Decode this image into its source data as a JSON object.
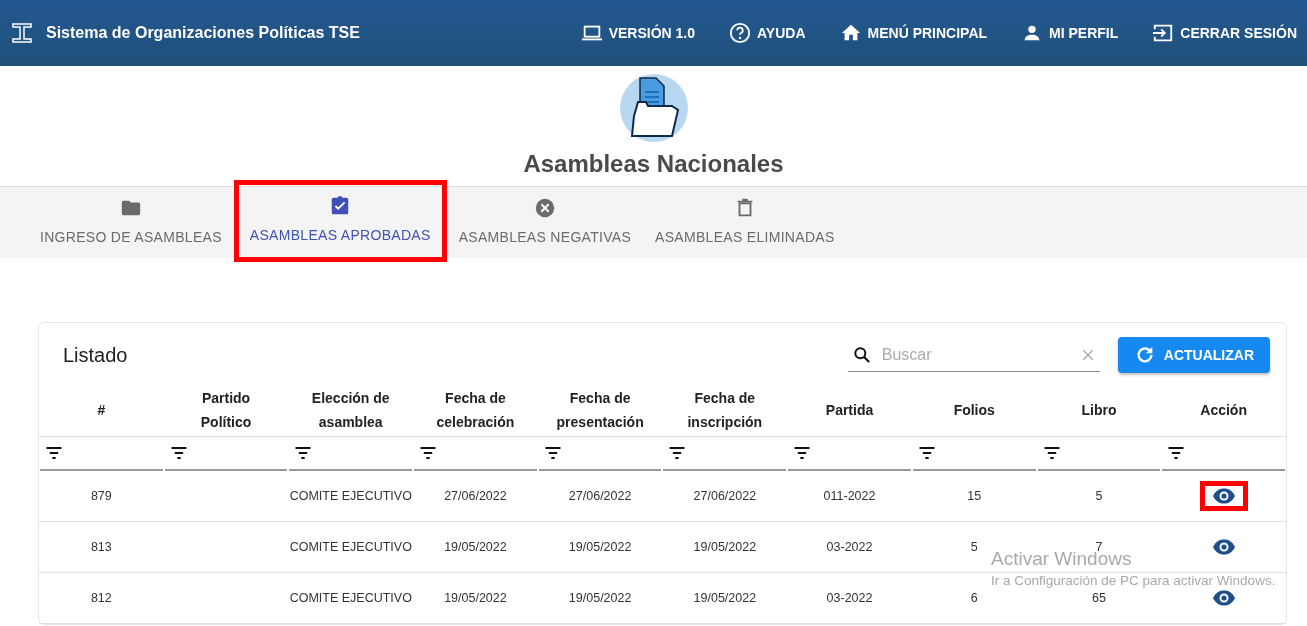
{
  "app_bar": {
    "title": "Sistema de Organizaciones Políticas TSE",
    "menu": [
      {
        "label": "VERSIÓN 1.0",
        "kind": "laptop"
      },
      {
        "label": "AYUDA",
        "kind": "help"
      },
      {
        "label": "MENÚ PRINCIPAL",
        "kind": "home"
      },
      {
        "label": "MI PERFIL",
        "kind": "person"
      },
      {
        "label": "CERRAR SESIÓN",
        "kind": "logout"
      }
    ]
  },
  "page_title": "Asambleas Nacionales",
  "tabs": [
    {
      "label": "INGRESO DE ASAMBLEAS",
      "kind": "folder",
      "selected": false,
      "highlighted": false
    },
    {
      "label": "ASAMBLEAS APROBADAS",
      "kind": "clipboard-check",
      "selected": true,
      "highlighted": true
    },
    {
      "label": "ASAMBLEAS NEGATIVAS",
      "kind": "cancel",
      "selected": false,
      "highlighted": false
    },
    {
      "label": "ASAMBLEAS ELIMINADAS",
      "kind": "trash",
      "selected": false,
      "highlighted": false
    }
  ],
  "listing": {
    "title": "Listado",
    "search": {
      "placeholder": "Buscar"
    },
    "refresh_button": "ACTUALIZAR",
    "columns": [
      "#",
      "Partido Político",
      "Elección de asamblea",
      "Fecha de celebración",
      "Fecha de presentación",
      "Fecha de inscripción",
      "Partida",
      "Folios",
      "Libro",
      "Acción"
    ],
    "rows": [
      {
        "cells": [
          "879",
          "",
          "COMITE EJECUTIVO",
          "27/06/2022",
          "27/06/2022",
          "27/06/2022",
          "011-2022",
          "15",
          "5"
        ],
        "action_highlighted": true
      },
      {
        "cells": [
          "813",
          "",
          "COMITE EJECUTIVO",
          "19/05/2022",
          "19/05/2022",
          "19/05/2022",
          "03-2022",
          "5",
          "7"
        ],
        "action_highlighted": false
      },
      {
        "cells": [
          "812",
          "",
          "COMITE EJECUTIVO",
          "19/05/2022",
          "19/05/2022",
          "19/05/2022",
          "03-2022",
          "6",
          "65"
        ],
        "action_highlighted": false
      }
    ]
  },
  "os_notice": {
    "title": "Activar Windows",
    "text": "Ir a Configuración de PC para activar Windows."
  }
}
